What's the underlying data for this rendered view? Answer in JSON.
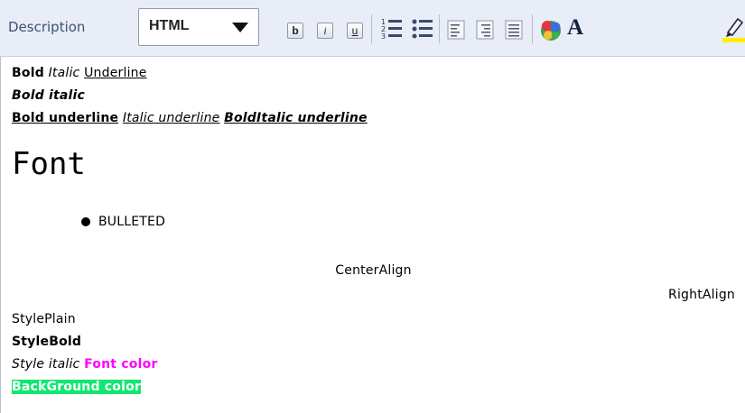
{
  "toolbar": {
    "label": "Description",
    "mode_select_value": "HTML",
    "bold_btn": "b",
    "italic_btn": "i",
    "underline_btn": "u",
    "font_btn": "A"
  },
  "content": {
    "line1": {
      "bold": "Bold",
      "italic": "Italic",
      "underline": "Underline"
    },
    "line2": {
      "bold_italic": "Bold italic"
    },
    "line3": {
      "bold_underline": "Bold underline",
      "italic_underline": "Italic underline",
      "bolditalic_underline": "BoldItalic underline"
    },
    "font_sample": "Font",
    "bulleted": "BULLETED",
    "center_align": "CenterAlign",
    "right_align": "RightAlign",
    "style_plain": "StylePlain",
    "style_bold": "StyleBold",
    "style_italic": "Style italic",
    "font_color": "Font color",
    "background_color": "BackGround color"
  },
  "colors": {
    "font_color": "#ff00ff",
    "background_color": "#10e870",
    "toolbar_bg": "#e8edf7"
  }
}
